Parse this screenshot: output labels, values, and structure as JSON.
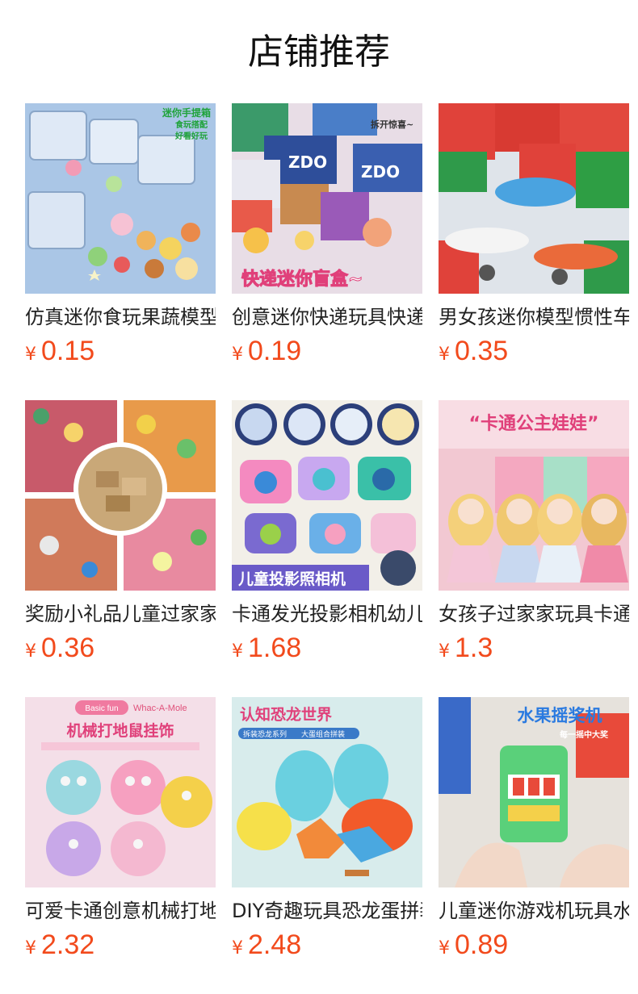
{
  "header": {
    "title": "店铺推荐"
  },
  "products": [
    {
      "name": "仿真迷你食玩果蔬模型",
      "currency": "¥",
      "price": "0.15",
      "image_icon": "mini-food-box-image",
      "overlay": [
        "迷你手提箱",
        "食玩搭配",
        "好看好玩"
      ]
    },
    {
      "name": "创意迷你快递玩具快递盒",
      "currency": "¥",
      "price": "0.19",
      "image_icon": "mini-express-box-image",
      "overlay": [
        "快递迷你盲盒~",
        "拆开惊喜~"
      ]
    },
    {
      "name": "男女孩迷你模型惯性车",
      "currency": "¥",
      "price": "0.35",
      "image_icon": "toy-plane-car-image",
      "overlay": []
    },
    {
      "name": "奖励小礼品儿童过家家玩具",
      "currency": "¥",
      "price": "0.36",
      "image_icon": "mini-gifts-collage-image",
      "overlay": []
    },
    {
      "name": "卡通发光投影相机幼儿园",
      "currency": "¥",
      "price": "1.68",
      "image_icon": "projector-camera-image",
      "overlay": [
        "儿童投影照相机"
      ]
    },
    {
      "name": "女孩子过家家玩具卡通娃娃",
      "currency": "¥",
      "price": "1.3",
      "image_icon": "princess-doll-image",
      "overlay": [
        "“卡通公主娃娃”"
      ]
    },
    {
      "name": "可爱卡通创意机械打地鼠",
      "currency": "¥",
      "price": "2.32",
      "image_icon": "whac-a-mole-image",
      "overlay": [
        "Basic fun",
        "Whac-A-Mole",
        "机械打地鼠挂饰"
      ]
    },
    {
      "name": "DIY奇趣玩具恐龙蛋拼装",
      "currency": "¥",
      "price": "2.48",
      "image_icon": "dinosaur-egg-image",
      "overlay": [
        "认知恐龙世界",
        "拆装恐龙系列",
        "大蛋组合拼装"
      ]
    },
    {
      "name": "儿童迷你游戏机玩具水果",
      "currency": "¥",
      "price": "0.89",
      "image_icon": "fruit-slot-machine-image",
      "overlay": [
        "水果摇奖机",
        "每一摇中大奖"
      ]
    }
  ],
  "colors": {
    "price": "#f24a1c",
    "title": "#111111",
    "name": "#222222"
  }
}
